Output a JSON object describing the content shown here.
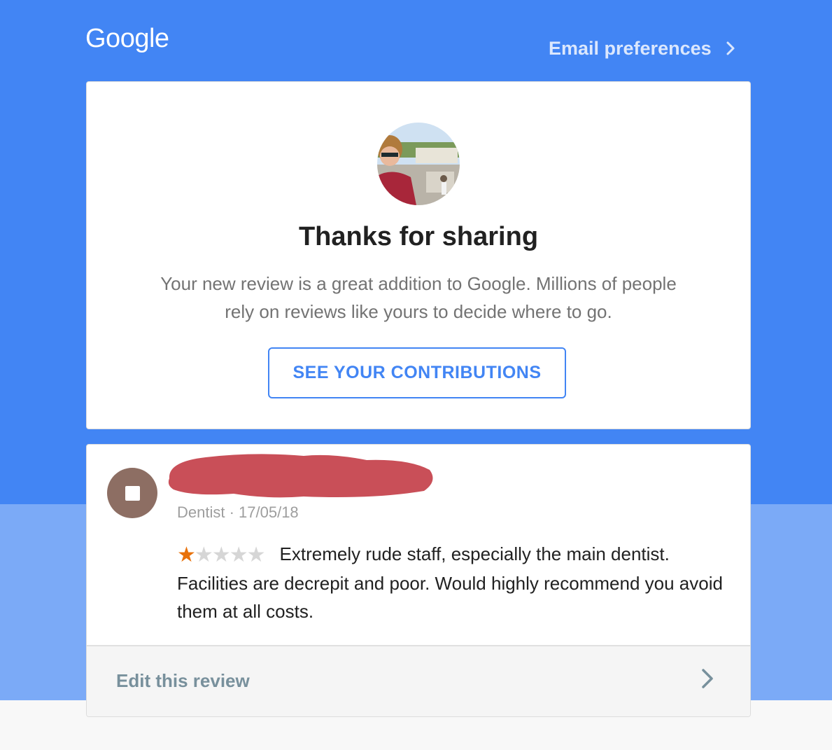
{
  "header": {
    "logo_text": "Google",
    "email_preferences_label": "Email preferences",
    "chevron_icon": "chevron-right-icon"
  },
  "confirmation_card": {
    "avatar_icon": "profile-photo",
    "title": "Thanks for sharing",
    "description": "Your new review is a great addition to Google. Millions of people rely on reviews like yours to decide where to go.",
    "button_label": "SEE YOUR CONTRIBUTIONS"
  },
  "review_card": {
    "place_icon": "place-icon",
    "place_name_redacted": true,
    "meta": "Dentist · 17/05/18",
    "rating": 1,
    "rating_max": 5,
    "review_text": "Extremely rude staff, especially the main dentist. Facilities are decrepit and poor. Would highly recommend you avoid them at all costs.",
    "edit_label": "Edit this review"
  },
  "colors": {
    "brand_blue": "#4285f4",
    "light_blue": "#7baaf7",
    "star_filled": "#e8710a",
    "star_empty": "#d6d6d6",
    "redaction": "#c94f58",
    "place_icon_bg": "#8d6e63"
  }
}
